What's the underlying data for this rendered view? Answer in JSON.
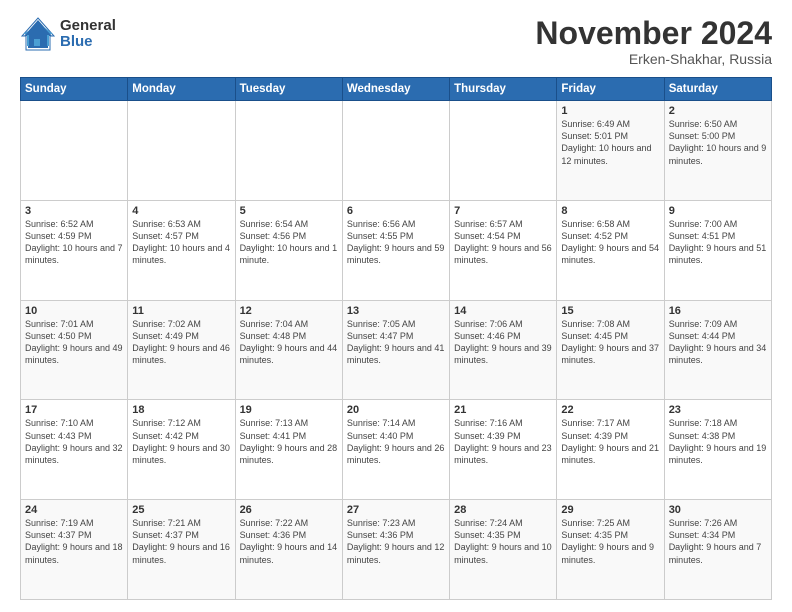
{
  "logo": {
    "general": "General",
    "blue": "Blue"
  },
  "header": {
    "title": "November 2024",
    "location": "Erken-Shakhar, Russia"
  },
  "weekdays": [
    "Sunday",
    "Monday",
    "Tuesday",
    "Wednesday",
    "Thursday",
    "Friday",
    "Saturday"
  ],
  "weeks": [
    [
      {
        "day": "",
        "info": ""
      },
      {
        "day": "",
        "info": ""
      },
      {
        "day": "",
        "info": ""
      },
      {
        "day": "",
        "info": ""
      },
      {
        "day": "",
        "info": ""
      },
      {
        "day": "1",
        "info": "Sunrise: 6:49 AM\nSunset: 5:01 PM\nDaylight: 10 hours and 12 minutes."
      },
      {
        "day": "2",
        "info": "Sunrise: 6:50 AM\nSunset: 5:00 PM\nDaylight: 10 hours and 9 minutes."
      }
    ],
    [
      {
        "day": "3",
        "info": "Sunrise: 6:52 AM\nSunset: 4:59 PM\nDaylight: 10 hours and 7 minutes."
      },
      {
        "day": "4",
        "info": "Sunrise: 6:53 AM\nSunset: 4:57 PM\nDaylight: 10 hours and 4 minutes."
      },
      {
        "day": "5",
        "info": "Sunrise: 6:54 AM\nSunset: 4:56 PM\nDaylight: 10 hours and 1 minute."
      },
      {
        "day": "6",
        "info": "Sunrise: 6:56 AM\nSunset: 4:55 PM\nDaylight: 9 hours and 59 minutes."
      },
      {
        "day": "7",
        "info": "Sunrise: 6:57 AM\nSunset: 4:54 PM\nDaylight: 9 hours and 56 minutes."
      },
      {
        "day": "8",
        "info": "Sunrise: 6:58 AM\nSunset: 4:52 PM\nDaylight: 9 hours and 54 minutes."
      },
      {
        "day": "9",
        "info": "Sunrise: 7:00 AM\nSunset: 4:51 PM\nDaylight: 9 hours and 51 minutes."
      }
    ],
    [
      {
        "day": "10",
        "info": "Sunrise: 7:01 AM\nSunset: 4:50 PM\nDaylight: 9 hours and 49 minutes."
      },
      {
        "day": "11",
        "info": "Sunrise: 7:02 AM\nSunset: 4:49 PM\nDaylight: 9 hours and 46 minutes."
      },
      {
        "day": "12",
        "info": "Sunrise: 7:04 AM\nSunset: 4:48 PM\nDaylight: 9 hours and 44 minutes."
      },
      {
        "day": "13",
        "info": "Sunrise: 7:05 AM\nSunset: 4:47 PM\nDaylight: 9 hours and 41 minutes."
      },
      {
        "day": "14",
        "info": "Sunrise: 7:06 AM\nSunset: 4:46 PM\nDaylight: 9 hours and 39 minutes."
      },
      {
        "day": "15",
        "info": "Sunrise: 7:08 AM\nSunset: 4:45 PM\nDaylight: 9 hours and 37 minutes."
      },
      {
        "day": "16",
        "info": "Sunrise: 7:09 AM\nSunset: 4:44 PM\nDaylight: 9 hours and 34 minutes."
      }
    ],
    [
      {
        "day": "17",
        "info": "Sunrise: 7:10 AM\nSunset: 4:43 PM\nDaylight: 9 hours and 32 minutes."
      },
      {
        "day": "18",
        "info": "Sunrise: 7:12 AM\nSunset: 4:42 PM\nDaylight: 9 hours and 30 minutes."
      },
      {
        "day": "19",
        "info": "Sunrise: 7:13 AM\nSunset: 4:41 PM\nDaylight: 9 hours and 28 minutes."
      },
      {
        "day": "20",
        "info": "Sunrise: 7:14 AM\nSunset: 4:40 PM\nDaylight: 9 hours and 26 minutes."
      },
      {
        "day": "21",
        "info": "Sunrise: 7:16 AM\nSunset: 4:39 PM\nDaylight: 9 hours and 23 minutes."
      },
      {
        "day": "22",
        "info": "Sunrise: 7:17 AM\nSunset: 4:39 PM\nDaylight: 9 hours and 21 minutes."
      },
      {
        "day": "23",
        "info": "Sunrise: 7:18 AM\nSunset: 4:38 PM\nDaylight: 9 hours and 19 minutes."
      }
    ],
    [
      {
        "day": "24",
        "info": "Sunrise: 7:19 AM\nSunset: 4:37 PM\nDaylight: 9 hours and 18 minutes."
      },
      {
        "day": "25",
        "info": "Sunrise: 7:21 AM\nSunset: 4:37 PM\nDaylight: 9 hours and 16 minutes."
      },
      {
        "day": "26",
        "info": "Sunrise: 7:22 AM\nSunset: 4:36 PM\nDaylight: 9 hours and 14 minutes."
      },
      {
        "day": "27",
        "info": "Sunrise: 7:23 AM\nSunset: 4:36 PM\nDaylight: 9 hours and 12 minutes."
      },
      {
        "day": "28",
        "info": "Sunrise: 7:24 AM\nSunset: 4:35 PM\nDaylight: 9 hours and 10 minutes."
      },
      {
        "day": "29",
        "info": "Sunrise: 7:25 AM\nSunset: 4:35 PM\nDaylight: 9 hours and 9 minutes."
      },
      {
        "day": "30",
        "info": "Sunrise: 7:26 AM\nSunset: 4:34 PM\nDaylight: 9 hours and 7 minutes."
      }
    ]
  ]
}
